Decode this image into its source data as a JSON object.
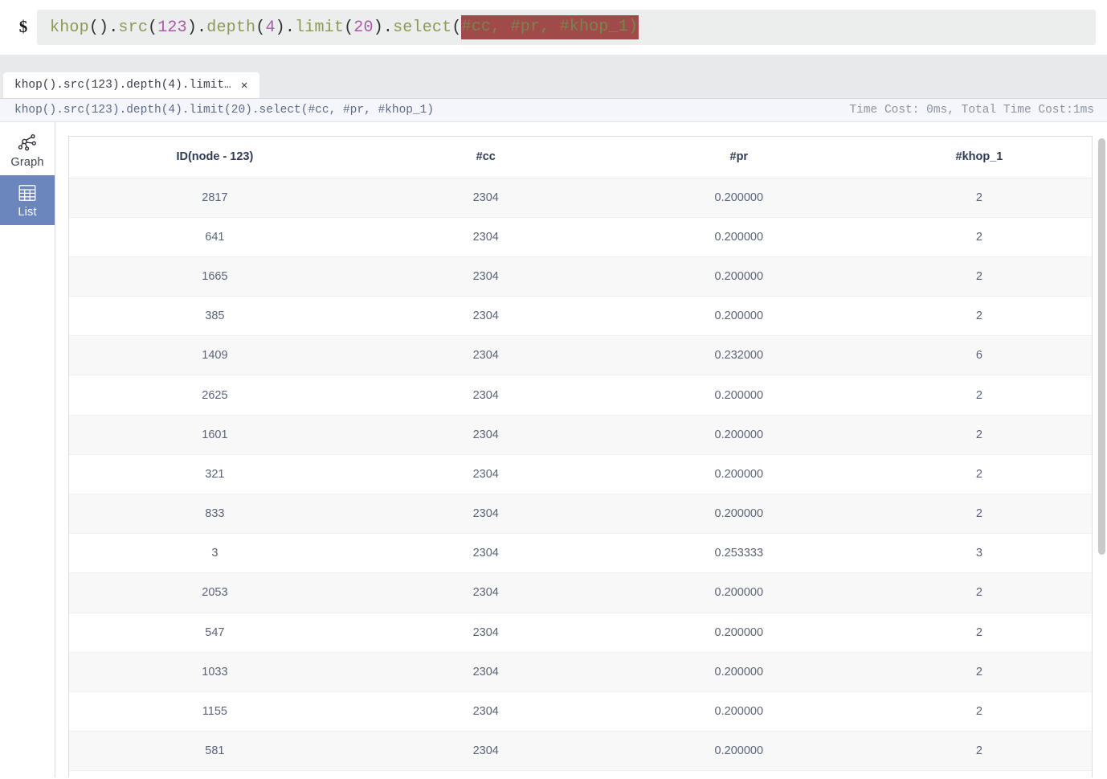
{
  "query_bar": {
    "prompt": "$",
    "query_tokens": [
      {
        "t": "khop",
        "k": "fn"
      },
      {
        "t": "().",
        "k": "punct"
      },
      {
        "t": "src",
        "k": "fn"
      },
      {
        "t": "(",
        "k": "punct"
      },
      {
        "t": "123",
        "k": "num"
      },
      {
        "t": ").",
        "k": "punct"
      },
      {
        "t": "depth",
        "k": "fn"
      },
      {
        "t": "(",
        "k": "punct"
      },
      {
        "t": "4",
        "k": "num"
      },
      {
        "t": ").",
        "k": "punct"
      },
      {
        "t": "limit",
        "k": "fn"
      },
      {
        "t": "(",
        "k": "punct"
      },
      {
        "t": "20",
        "k": "num"
      },
      {
        "t": ").",
        "k": "punct"
      },
      {
        "t": "select",
        "k": "fn"
      },
      {
        "t": "(",
        "k": "punct"
      }
    ],
    "selected_text": "#cc, #pr, #khop_1)",
    "selection_color": "#a14a4a",
    "full_query": "khop().src(123).depth(4).limit(20).select(#cc, #pr, #khop_1)"
  },
  "tab_bar": {
    "tabs": [
      {
        "label": "khop().src(123).depth(4).limit…",
        "close_icon": "×",
        "active": true
      }
    ]
  },
  "result_header": {
    "query_echo": "khop().src(123).depth(4).limit(20).select(#cc, #pr, #khop_1)",
    "time_cost": "Time Cost: 0ms, Total Time Cost:1ms"
  },
  "sidebar": {
    "items": [
      {
        "label": "Graph",
        "icon": "graph-network-icon",
        "selected": false
      },
      {
        "label": "List",
        "icon": "table-grid-icon",
        "selected": true
      }
    ],
    "selected_color": "#6b86bd"
  },
  "table": {
    "columns": [
      "ID(node - 123)",
      "#cc",
      "#pr",
      "#khop_1"
    ],
    "rows": [
      [
        "2817",
        "2304",
        "0.200000",
        "2"
      ],
      [
        "641",
        "2304",
        "0.200000",
        "2"
      ],
      [
        "1665",
        "2304",
        "0.200000",
        "2"
      ],
      [
        "385",
        "2304",
        "0.200000",
        "2"
      ],
      [
        "1409",
        "2304",
        "0.232000",
        "6"
      ],
      [
        "2625",
        "2304",
        "0.200000",
        "2"
      ],
      [
        "1601",
        "2304",
        "0.200000",
        "2"
      ],
      [
        "321",
        "2304",
        "0.200000",
        "2"
      ],
      [
        "833",
        "2304",
        "0.200000",
        "2"
      ],
      [
        "3",
        "2304",
        "0.253333",
        "3"
      ],
      [
        "2053",
        "2304",
        "0.200000",
        "2"
      ],
      [
        "547",
        "2304",
        "0.200000",
        "2"
      ],
      [
        "1033",
        "2304",
        "0.200000",
        "2"
      ],
      [
        "1155",
        "2304",
        "0.200000",
        "2"
      ],
      [
        "581",
        "2304",
        "0.200000",
        "2"
      ]
    ]
  }
}
